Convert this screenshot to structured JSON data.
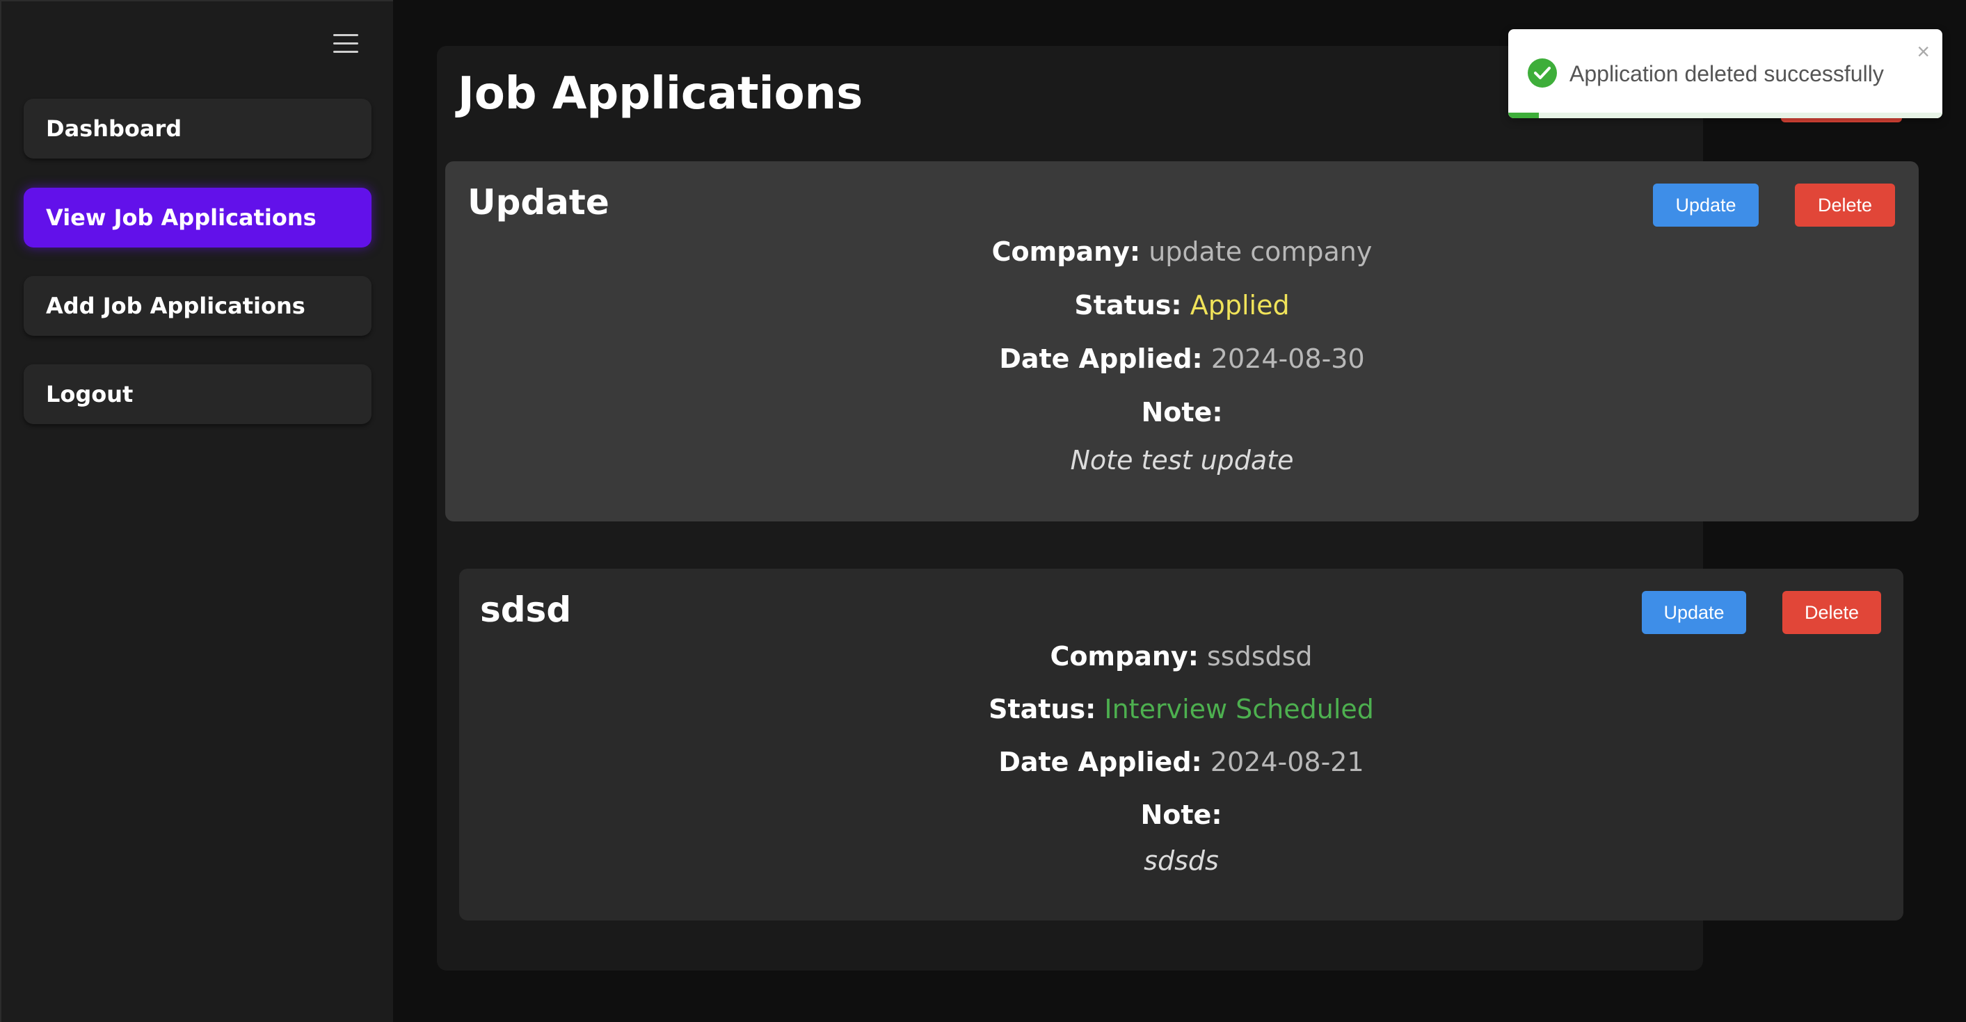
{
  "sidebar": {
    "items": [
      {
        "label": "Dashboard"
      },
      {
        "label": "View Job Applications"
      },
      {
        "label": "Add Job Applications"
      },
      {
        "label": "Logout"
      }
    ]
  },
  "main": {
    "title": "Job Applications",
    "applications": [
      {
        "title": "Update",
        "company_label": "Company:",
        "company": "update company",
        "status_label": "Status:",
        "status": "Applied",
        "date_label": "Date Applied:",
        "date": "2024-08-30",
        "note_label": "Note:",
        "note": "Note test update",
        "update_label": "Update",
        "delete_label": "Delete"
      },
      {
        "title": "sdsd",
        "company_label": "Company:",
        "company": "ssdsdsd",
        "status_label": "Status:",
        "status": "Interview Scheduled",
        "date_label": "Date Applied:",
        "date": "2024-08-21",
        "note_label": "Note:",
        "note": "sdsds",
        "update_label": "Update",
        "delete_label": "Delete"
      }
    ]
  },
  "toast": {
    "message": "Application deleted successfully",
    "close": "×",
    "progress": 0.07
  },
  "colors": {
    "accent": "#6211ea",
    "update_button": "#3e8ee8",
    "delete_button": "#e14638",
    "status_applied": "#f0e35a",
    "status_interview": "#4db04f",
    "success": "#3eae3a"
  },
  "icons": {
    "menu": "hamburger-menu-icon",
    "toast_success": "check-circle-icon",
    "toast_close": "close-icon"
  }
}
